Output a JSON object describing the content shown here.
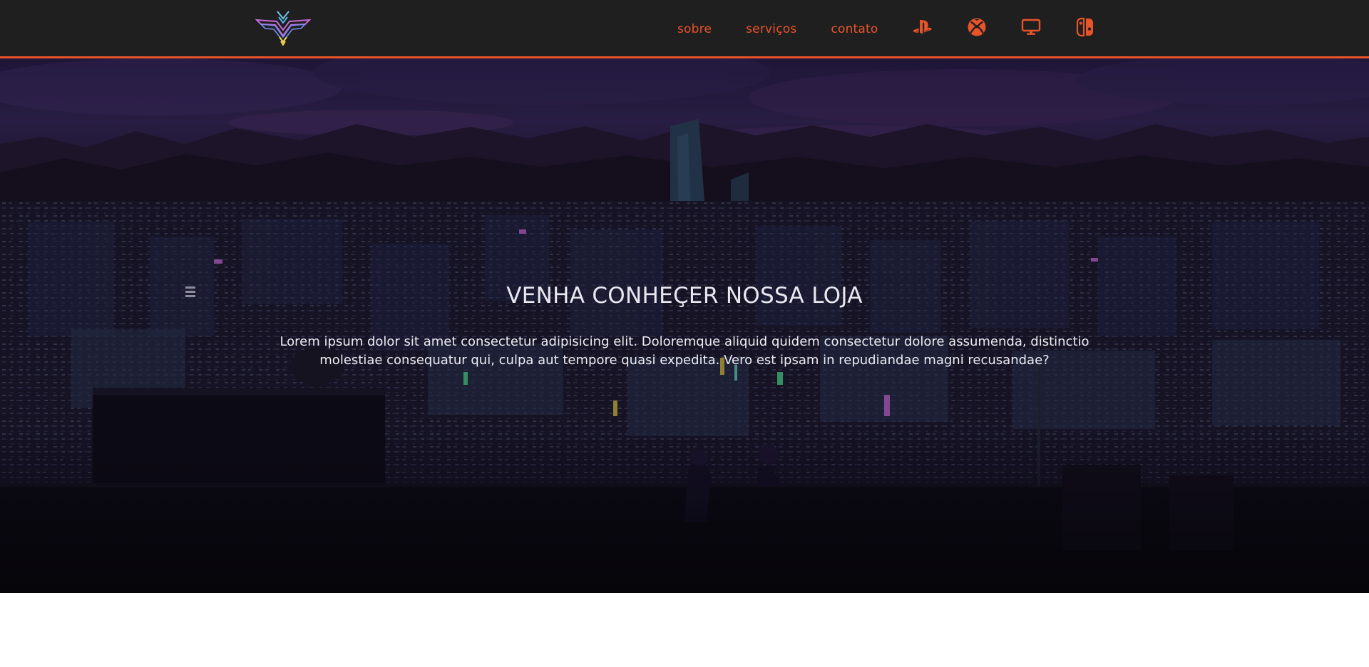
{
  "brand": {
    "logo": "winged-chevron-logo",
    "accent_color": "#e8542a",
    "header_bg": "#1f1f1f"
  },
  "nav": {
    "links": [
      {
        "label": "sobre"
      },
      {
        "label": "serviços"
      },
      {
        "label": "contato"
      }
    ],
    "icons": [
      {
        "name": "playstation-icon"
      },
      {
        "name": "xbox-icon"
      },
      {
        "name": "desktop-icon"
      },
      {
        "name": "switch-icon"
      }
    ]
  },
  "hero": {
    "title": "VENHA CONHEÇER NOSSA LOJA",
    "text": "Lorem ipsum dolor sit amet consectetur adipisicing elit. Doloremque aliquid quidem consectetur dolore assumenda, distinctio molestiae consequatur qui, culpa aut tempore quasi expedita. Vero est ipsam in repudiandae magni recusandae?"
  }
}
